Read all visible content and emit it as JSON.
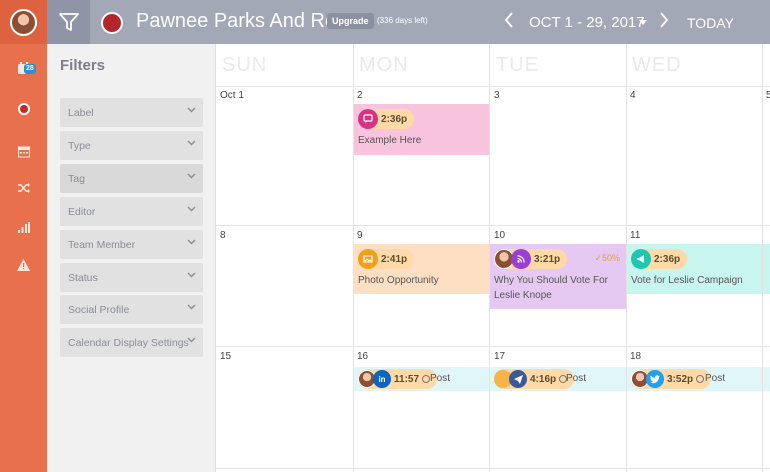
{
  "header": {
    "brand_name": "Pawnee Parks And Rec",
    "upgrade_label": "Upgrade",
    "days_left": "(336 days left)",
    "date_range": "OCT 1 - 29, 2017",
    "today_label": "TODAY",
    "brand_color": "#b3262a"
  },
  "rail": {
    "calendar_badge": "28",
    "icons": [
      "calendar-icon",
      "record-icon",
      "list-calendar-icon",
      "shuffle-icon",
      "analytics-icon",
      "alert-icon"
    ]
  },
  "filters": {
    "title": "Filters",
    "items": [
      {
        "label": "Label"
      },
      {
        "label": "Type"
      },
      {
        "label": "Tag"
      },
      {
        "label": "Editor"
      },
      {
        "label": "Team Member"
      },
      {
        "label": "Status"
      },
      {
        "label": "Social Profile"
      },
      {
        "label": "Calendar Display Settings"
      }
    ]
  },
  "calendar": {
    "weekdays": [
      "SUN",
      "MON",
      "TUE",
      "WED"
    ],
    "week1": [
      "Oct 1",
      "2",
      "3",
      "4",
      "5"
    ],
    "week2": [
      "8",
      "9",
      "10",
      "11"
    ],
    "week3": [
      "15",
      "16",
      "17",
      "18"
    ],
    "events": {
      "e1": {
        "time": "2:36p",
        "title": "Example Here"
      },
      "e2": {
        "time": "2:41p",
        "title": "Photo Opportunity"
      },
      "e3": {
        "time": "3:21p",
        "title": "Why You Should Vote For Leslie Knope",
        "progress": "50%"
      },
      "e4": {
        "time": "2:36p",
        "title": "Vote for Leslie Campaign"
      },
      "e5": {
        "time": "11:57",
        "label": "Post"
      },
      "e6": {
        "time": "4:16p",
        "label": "Post"
      },
      "e7": {
        "time": "3:52p",
        "label": "Post"
      }
    }
  }
}
